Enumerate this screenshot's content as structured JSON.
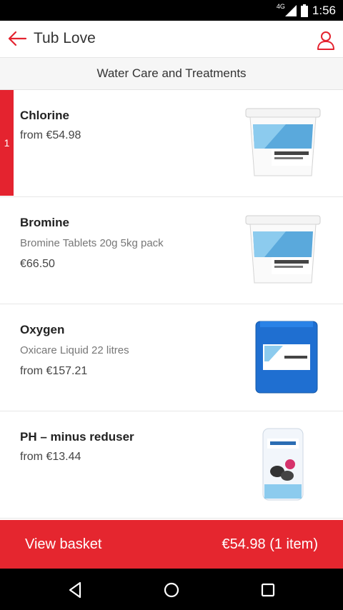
{
  "status_bar": {
    "network": "4G",
    "time": "1:56"
  },
  "app_bar": {
    "title": "Tub Love"
  },
  "subheader": {
    "title": "Water Care and Treatments"
  },
  "products": [
    {
      "name": "Chlorine",
      "description": "",
      "price": "from €54.98",
      "badge": "1",
      "image": "chlorine-tub-image"
    },
    {
      "name": "Bromine",
      "description": "Bromine Tablets 20g 5kg pack",
      "price": "€66.50",
      "badge": "",
      "image": "bromine-tub-image"
    },
    {
      "name": "Oxygen",
      "description": "Oxicare Liquid 22 litres",
      "price": "from €157.21",
      "badge": "",
      "image": "oxygen-canister-image"
    },
    {
      "name": "PH – minus reduser",
      "description": "",
      "price": "from €13.44",
      "badge": "",
      "image": "ph-bottle-image"
    }
  ],
  "basket": {
    "label": "View basket",
    "total": "€54.98 (1 item)"
  },
  "colors": {
    "accent": "#e4232f",
    "text": "#222222",
    "muted": "#777777"
  }
}
